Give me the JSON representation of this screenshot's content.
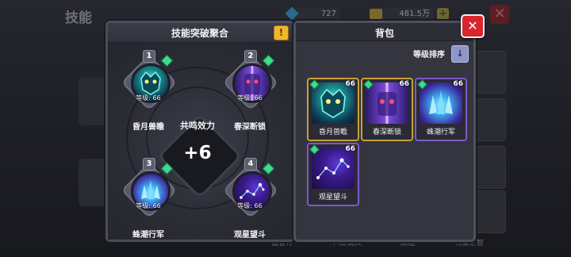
{
  "background": {
    "page_title": "技能",
    "gems": "727",
    "gold": "481.5万",
    "plus": "+",
    "close": "✕",
    "bottom_labels": [
      "俄答行",
      "八卦离火",
      "底施",
      "元素之智"
    ]
  },
  "fusion_panel": {
    "title": "技能突破聚合",
    "info_icon": "!",
    "resonance_label": "共鸣效力",
    "resonance_value": "+6",
    "slots": [
      {
        "number": "1",
        "name": "昏月兽瞻",
        "level": "等级: 66",
        "art": "teal"
      },
      {
        "number": "2",
        "name": "春深断锁",
        "level": "等级: 66",
        "art": "purple"
      },
      {
        "number": "3",
        "name": "蛛潮行军",
        "level": "等级: 66",
        "art": "crystal"
      },
      {
        "number": "4",
        "name": "观星望斗",
        "level": "等级: 66",
        "art": "stars"
      }
    ]
  },
  "bag_panel": {
    "title": "背包",
    "sort_label": "等级排序",
    "sort_icon": "↓",
    "close_icon": "✕",
    "items": [
      {
        "name": "昏月兽瞻",
        "level": "66",
        "art": "teal",
        "frame": "gold"
      },
      {
        "name": "春深断锁",
        "level": "66",
        "art": "purple",
        "frame": "gold"
      },
      {
        "name": "蛛潮行军",
        "level": "66",
        "art": "crystal",
        "frame": "purple"
      },
      {
        "name": "观星望斗",
        "level": "66",
        "art": "stars",
        "frame": "purple"
      }
    ]
  },
  "colors": {
    "accent_gem": "#3ddc8a",
    "close_red": "#d8262c",
    "info_yellow": "#f1b72a",
    "sort_button": "#8e95c8"
  }
}
